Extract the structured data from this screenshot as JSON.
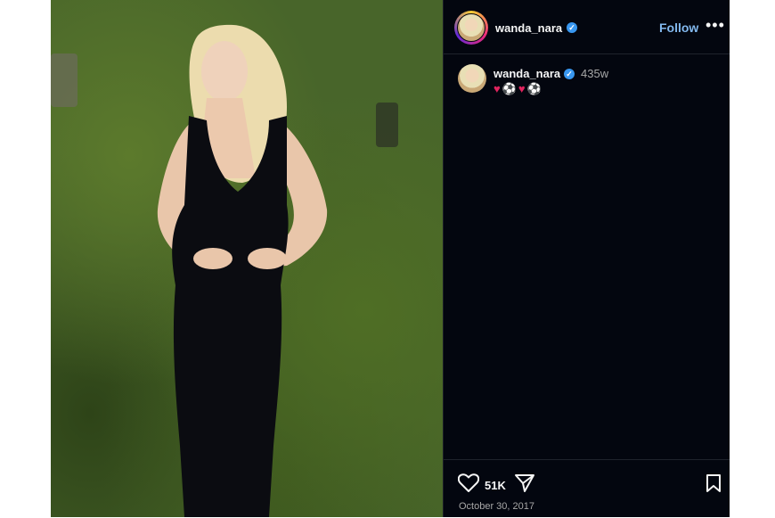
{
  "post": {
    "username": "wanda_nara",
    "follow_label": "Follow",
    "more_label": "•••"
  },
  "caption": {
    "username": "wanda_nara",
    "age": "435w",
    "emojis": [
      "♥",
      "⚽",
      "♥",
      "⚽"
    ]
  },
  "stats": {
    "likes": "51K",
    "date": "October 30, 2017"
  },
  "icons": {
    "verified": "verified-badge-icon",
    "like": "heart-icon",
    "share": "send-icon",
    "save": "bookmark-icon",
    "more": "more-options-icon"
  },
  "colors": {
    "panel_bg": "#03060f",
    "follow": "#82b8ee",
    "verified": "#3897f0"
  }
}
